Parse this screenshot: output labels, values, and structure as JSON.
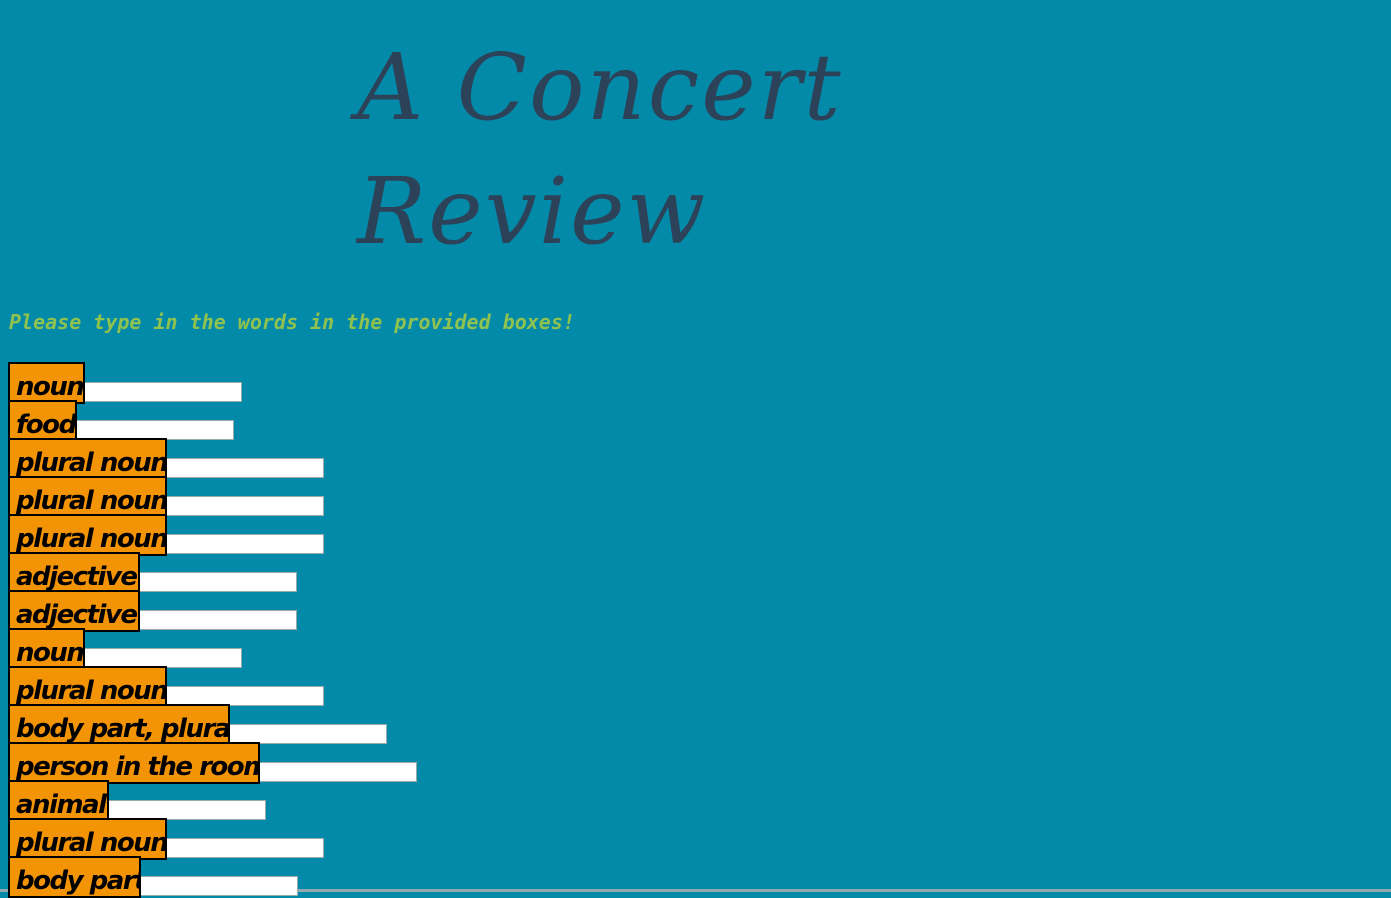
{
  "page": {
    "title_lines": [
      "A Concert",
      "Review"
    ],
    "instructions": "Please type in the words in the provided boxes!"
  },
  "fields": [
    {
      "label": "noun",
      "value": ""
    },
    {
      "label": "food",
      "value": ""
    },
    {
      "label": "plural noun",
      "value": ""
    },
    {
      "label": "plural noun",
      "value": ""
    },
    {
      "label": "plural noun",
      "value": ""
    },
    {
      "label": "adjective",
      "value": ""
    },
    {
      "label": "adjective",
      "value": ""
    },
    {
      "label": "noun",
      "value": ""
    },
    {
      "label": "plural noun",
      "value": ""
    },
    {
      "label": "body part, plural",
      "value": ""
    },
    {
      "label": "person in the room",
      "value": ""
    },
    {
      "label": "animal",
      "value": ""
    },
    {
      "label": "plural noun",
      "value": ""
    },
    {
      "label": "body part",
      "value": ""
    }
  ],
  "colors": {
    "background": "#048aa9",
    "title": "#2c4258",
    "instructions": "#8fc24e",
    "label_background": "#f39406"
  }
}
